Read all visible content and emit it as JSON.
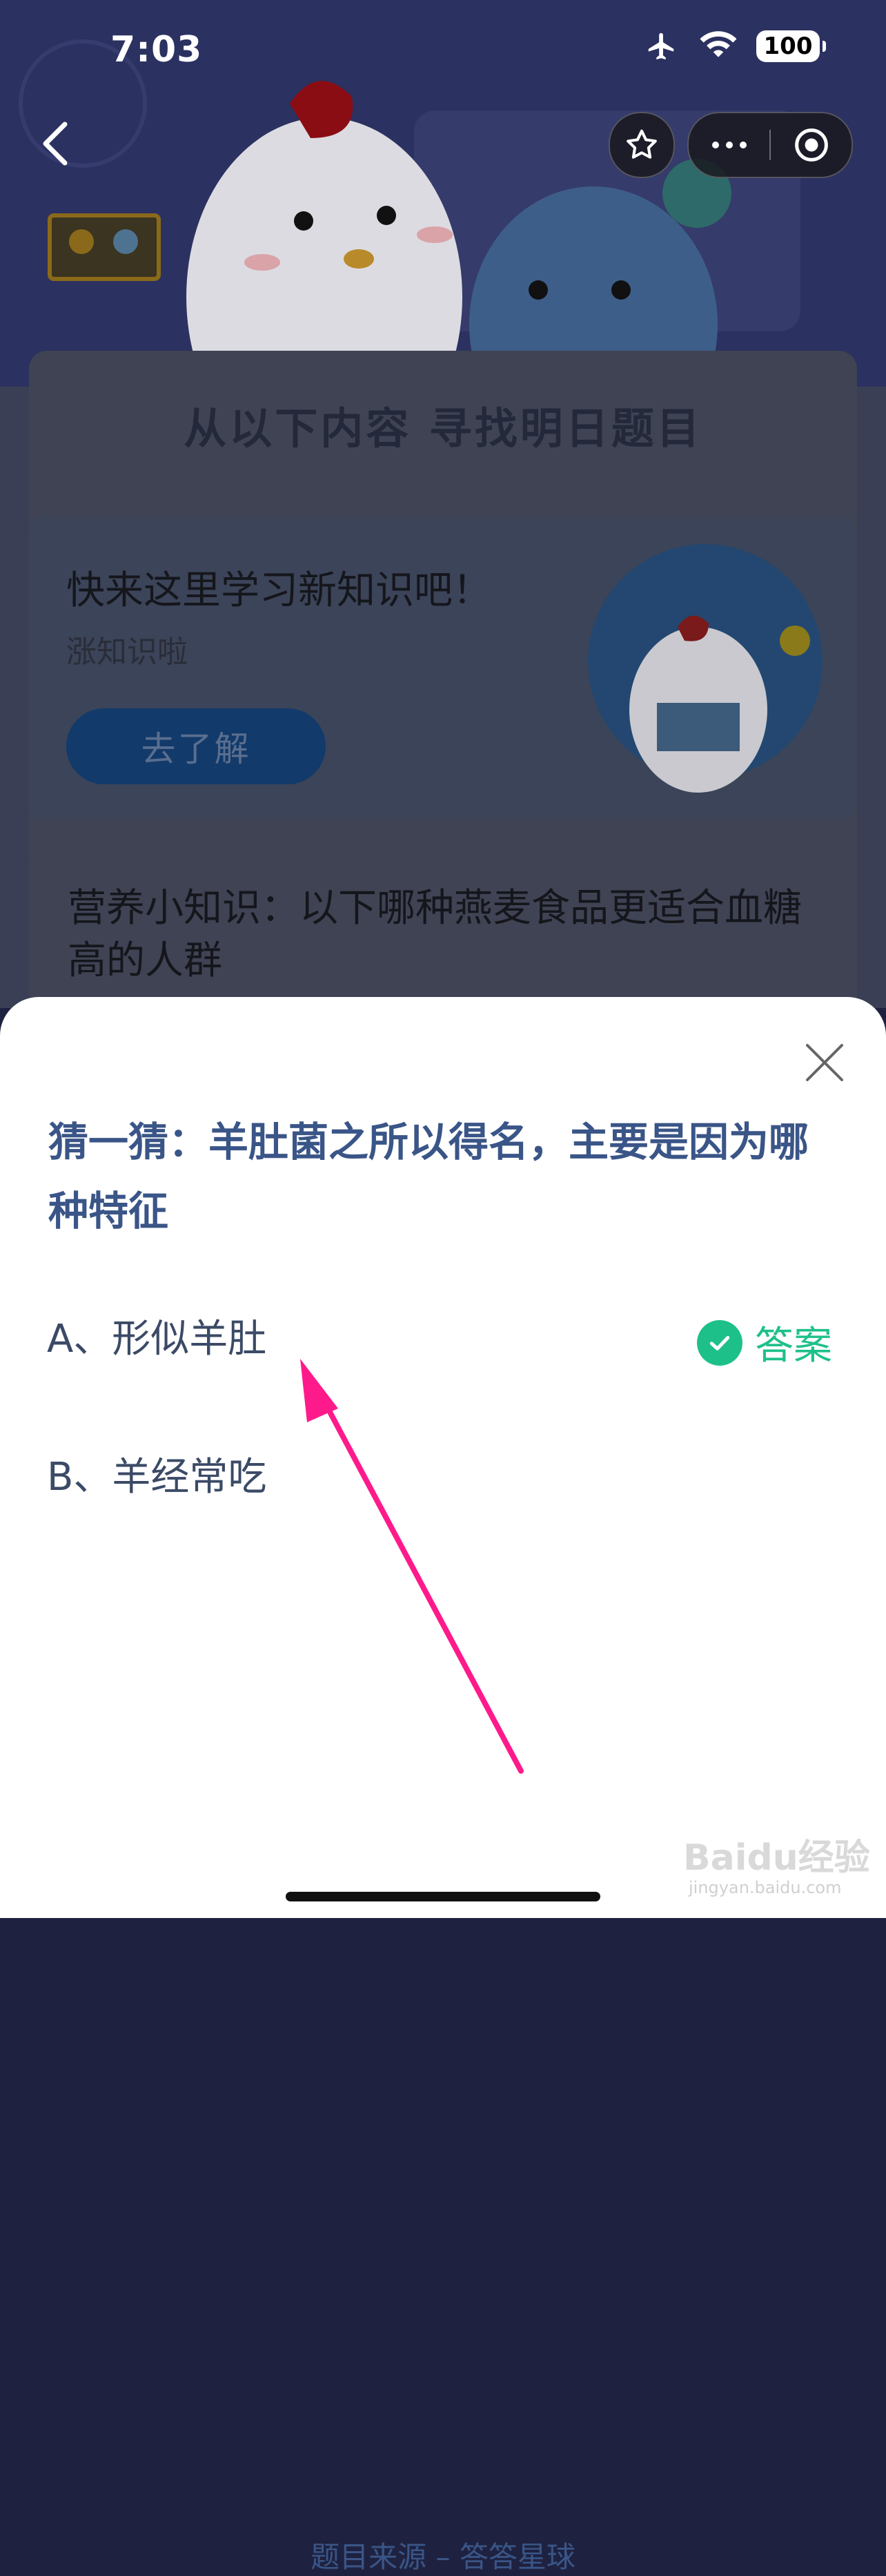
{
  "status_bar": {
    "time": "7:03",
    "battery": "100"
  },
  "nav": {
    "back_icon": "chevron-left-icon",
    "star_icon": "star-icon",
    "more_icon": "more-dots-icon",
    "target_icon": "target-icon"
  },
  "background": {
    "section_title": "从以下内容 寻找明日题目",
    "promo": {
      "title": "快来这里学习新知识吧！",
      "subtitle": "涨知识啦",
      "button": "去了解"
    },
    "knowledge": {
      "title": "营养小知识：以下哪种燕麦食品更适合血糖高的人群"
    }
  },
  "sheet": {
    "question": "猜一猜：羊肚菌之所以得名，主要是因为哪种特征",
    "options": [
      {
        "label": "A、形似羊肚",
        "is_answer": true
      },
      {
        "label": "B、羊经常吃",
        "is_answer": false
      }
    ],
    "answer_label": "答案",
    "source": "题目来源 – 答答星球"
  },
  "watermark": {
    "text": "Baidu经验",
    "sub": "jingyan.baidu.com"
  },
  "colors": {
    "accent_green": "#1ec08a",
    "question_blue": "#3a5587",
    "arrow_pink": "#ff1a8c"
  }
}
